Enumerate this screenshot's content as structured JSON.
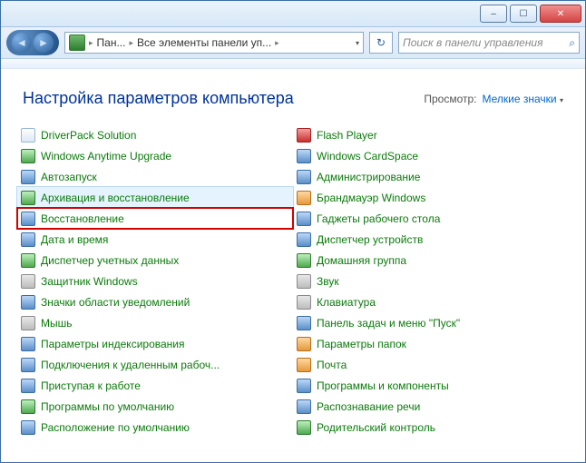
{
  "titlebar": {
    "min_label": "–",
    "max_label": "☐",
    "close_label": "✕"
  },
  "toolbar": {
    "back_glyph": "◄",
    "fwd_glyph": "►",
    "crumb1": "Пан...",
    "crumb2": "Все элементы панели уп...",
    "refresh_glyph": "↻",
    "search_placeholder": "Поиск в панели управления",
    "search_glyph": "⌕"
  },
  "header": {
    "title": "Настройка параметров компьютера",
    "viewby_label": "Просмотр:",
    "viewby_value": "Мелкие значки"
  },
  "left_column": [
    {
      "label": "DriverPack Solution",
      "icon": "doc",
      "interactable": true
    },
    {
      "label": "Windows Anytime Upgrade",
      "icon": "green",
      "interactable": true
    },
    {
      "label": "Автозапуск",
      "icon": "blue",
      "interactable": true
    },
    {
      "label": "Архивация и восстановление",
      "icon": "green",
      "interactable": true,
      "hover": true
    },
    {
      "label": "Восстановление",
      "icon": "blue",
      "interactable": true,
      "highlight": true
    },
    {
      "label": "Дата и время",
      "icon": "blue",
      "interactable": true
    },
    {
      "label": "Диспетчер учетных данных",
      "icon": "green",
      "interactable": true
    },
    {
      "label": "Защитник Windows",
      "icon": "grey",
      "interactable": true
    },
    {
      "label": "Значки области уведомлений",
      "icon": "blue",
      "interactable": true
    },
    {
      "label": "Мышь",
      "icon": "grey",
      "interactable": true
    },
    {
      "label": "Параметры индексирования",
      "icon": "blue",
      "interactable": true
    },
    {
      "label": "Подключения к удаленным рабоч...",
      "icon": "blue",
      "interactable": true
    },
    {
      "label": "Приступая к работе",
      "icon": "blue",
      "interactable": true
    },
    {
      "label": "Программы по умолчанию",
      "icon": "green",
      "interactable": true
    },
    {
      "label": "Расположение по умолчанию",
      "icon": "blue",
      "interactable": true
    }
  ],
  "right_column": [
    {
      "label": "Flash Player",
      "icon": "red",
      "interactable": true
    },
    {
      "label": "Windows CardSpace",
      "icon": "blue",
      "interactable": true
    },
    {
      "label": "Администрирование",
      "icon": "blue",
      "interactable": true
    },
    {
      "label": "Брандмауэр Windows",
      "icon": "orange",
      "interactable": true
    },
    {
      "label": "Гаджеты рабочего стола",
      "icon": "blue",
      "interactable": true
    },
    {
      "label": "Диспетчер устройств",
      "icon": "blue",
      "interactable": true
    },
    {
      "label": "Домашняя группа",
      "icon": "green",
      "interactable": true
    },
    {
      "label": "Звук",
      "icon": "grey",
      "interactable": true
    },
    {
      "label": "Клавиатура",
      "icon": "grey",
      "interactable": true
    },
    {
      "label": "Панель задач и меню \"Пуск\"",
      "icon": "blue",
      "interactable": true
    },
    {
      "label": "Параметры папок",
      "icon": "orange",
      "interactable": true
    },
    {
      "label": "Почта",
      "icon": "orange",
      "interactable": true
    },
    {
      "label": "Программы и компоненты",
      "icon": "blue",
      "interactable": true
    },
    {
      "label": "Распознавание речи",
      "icon": "blue",
      "interactable": true
    },
    {
      "label": "Родительский контроль",
      "icon": "green",
      "interactable": true
    }
  ]
}
